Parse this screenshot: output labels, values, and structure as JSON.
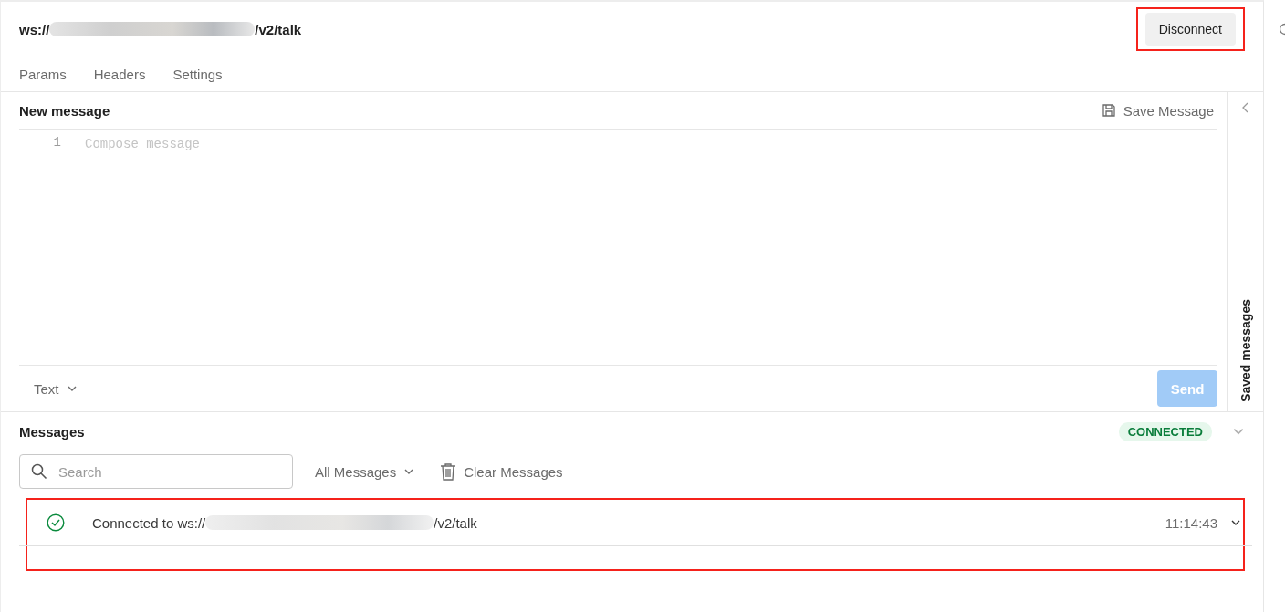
{
  "request": {
    "url_start": "ws://",
    "url_end": "/v2/talk",
    "redacted": true
  },
  "connect_button": {
    "label": "Disconnect",
    "highlighted": true
  },
  "tabs": [
    {
      "label": "Params",
      "selected": false
    },
    {
      "label": "Headers",
      "selected": false
    },
    {
      "label": "Settings",
      "selected": false
    }
  ],
  "composer": {
    "title": "New message",
    "save_label": "Save Message",
    "line_number": "1",
    "placeholder": "Compose message",
    "format": "Text",
    "send": {
      "label": "Send",
      "disabled": true
    }
  },
  "saved_panel": {
    "title": "Saved messages",
    "expanded": false
  },
  "messages": {
    "title": "Messages",
    "status": "CONNECTED",
    "search_placeholder": "Search",
    "filter": "All Messages",
    "clear_label": "Clear Messages",
    "items": [
      {
        "kind": "connected",
        "text_start": "Connected to ws://",
        "text_end": "/v2/talk",
        "redacted": true,
        "time": "11:14:43",
        "highlighted": true
      }
    ]
  }
}
